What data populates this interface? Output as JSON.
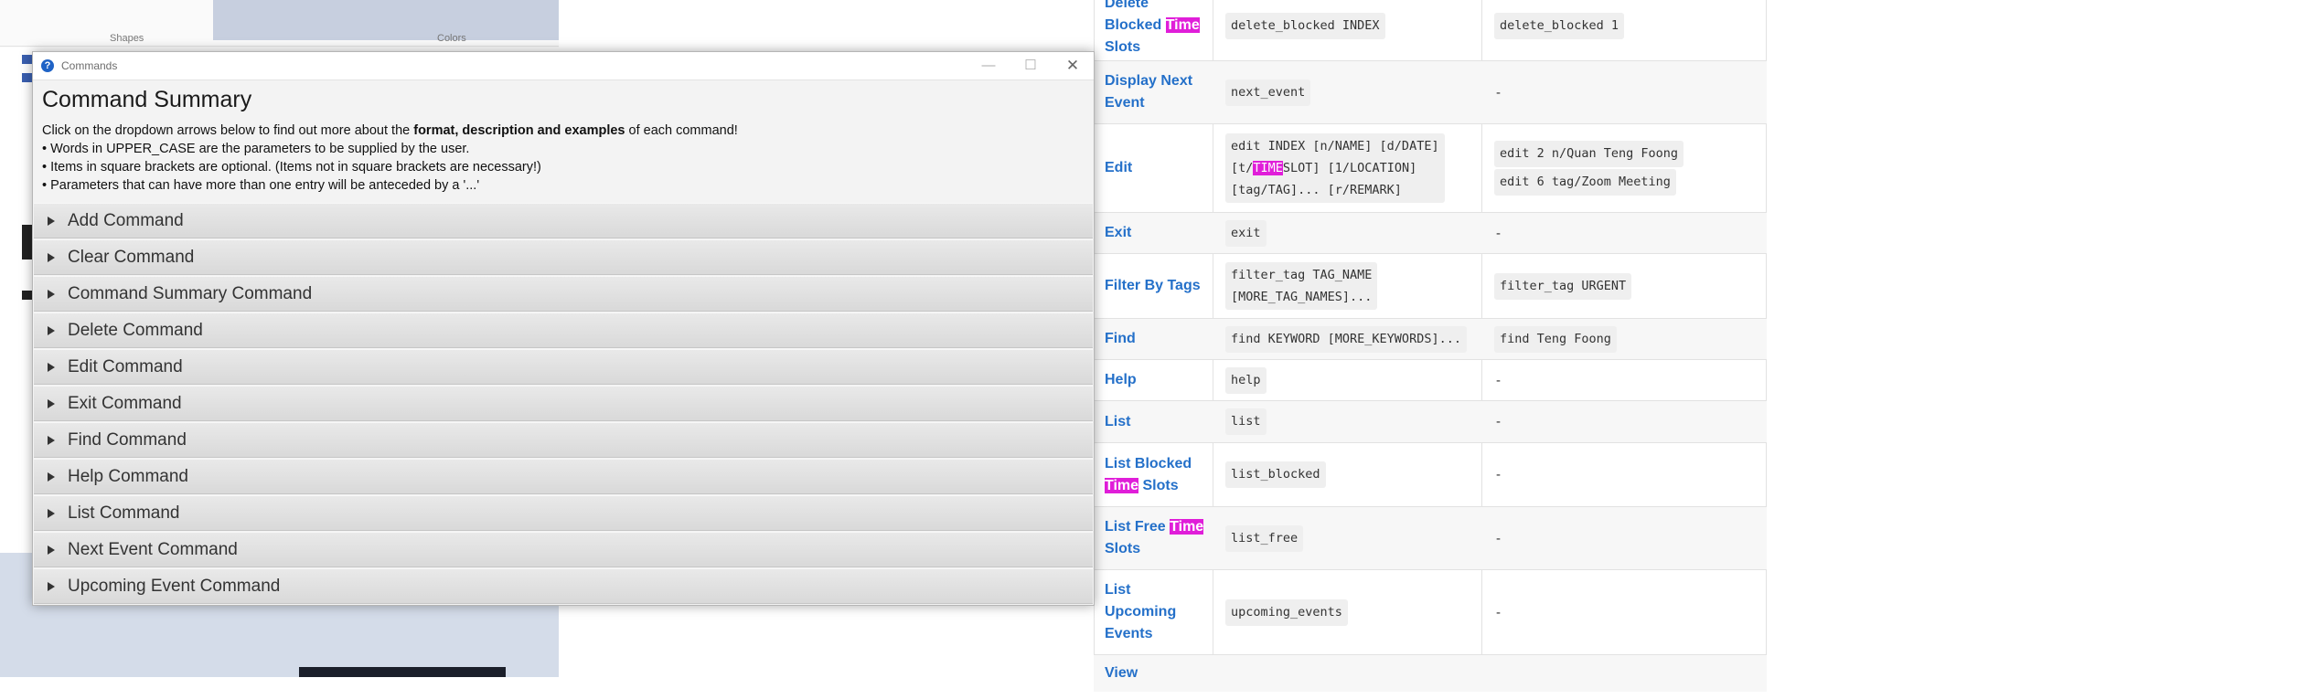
{
  "background_app": {
    "ribbon_labels": [
      "Shapes",
      "Colors"
    ]
  },
  "commands_window": {
    "window_title": "Commands",
    "controls": {
      "minimize": "—",
      "maximize": "☐",
      "close": "✕"
    },
    "heading": "Command Summary",
    "intro_before": "Click on the dropdown arrows below to find out more about the ",
    "intro_bold": "format, description and examples",
    "intro_after": " of each command!",
    "bullets": [
      "• Words in UPPER_CASE are the parameters to be supplied by the user.",
      "• Items in square brackets are optional. (Items not in square brackets are necessary!)",
      "• Parameters that can have more than one entry will be anteceded by a '...'"
    ],
    "sections": [
      "Add Command",
      "Clear Command",
      "Command Summary Command",
      "Delete Command",
      "Edit Command",
      "Exit Command",
      "Find Command",
      "Help Command",
      "List Command",
      "Next Event Command",
      "Upcoming Event Command"
    ]
  },
  "doc_table": {
    "highlight_term": "Time",
    "rows": {
      "delete_blocked": {
        "cmd_pre": "Delete Blocked ",
        "cmd_hl": "Time",
        "cmd_post": " Slots",
        "format": "delete_blocked INDEX",
        "example": "delete_blocked 1"
      },
      "next_event": {
        "cmd": "Display Next Event",
        "format": "next_event",
        "example": "-"
      },
      "edit": {
        "cmd": "Edit",
        "format_line1": "edit INDEX [n/NAME] [d/DATE]",
        "format_line2_pre": "[t/",
        "format_line2_hl": "TIME",
        "format_line2_post": "SLOT] [1/LOCATION]",
        "format_line3": "[tag/TAG]... [r/REMARK]",
        "example1": "edit 2 n/Quan Teng Foong",
        "example2": "edit 6 tag/Zoom Meeting"
      },
      "exit": {
        "cmd": "Exit",
        "format": "exit",
        "example": "-"
      },
      "filter_tag": {
        "cmd": "Filter By Tags",
        "format_line1": "filter_tag TAG_NAME",
        "format_line2": "[MORE_TAG_NAMES]...",
        "example": "filter_tag URGENT"
      },
      "find": {
        "cmd": "Find",
        "format": "find KEYWORD [MORE_KEYWORDS]...",
        "example": "find Teng Foong"
      },
      "help": {
        "cmd": "Help",
        "format": "help",
        "example": "-"
      },
      "list": {
        "cmd": "List",
        "format": "list",
        "example": "-"
      },
      "list_blocked": {
        "cmd_pre": "List Blocked ",
        "cmd_hl": "Time",
        "cmd_post": " Slots",
        "format": "list_blocked",
        "example": "-"
      },
      "list_free": {
        "cmd_pre": "List Free ",
        "cmd_hl": "Time",
        "cmd_post": " Slots",
        "format": "list_free",
        "example": "-"
      },
      "upcoming": {
        "cmd": "List Upcoming Events",
        "format": "upcoming_events",
        "example": "-"
      },
      "view": {
        "cmd": "View"
      }
    }
  }
}
